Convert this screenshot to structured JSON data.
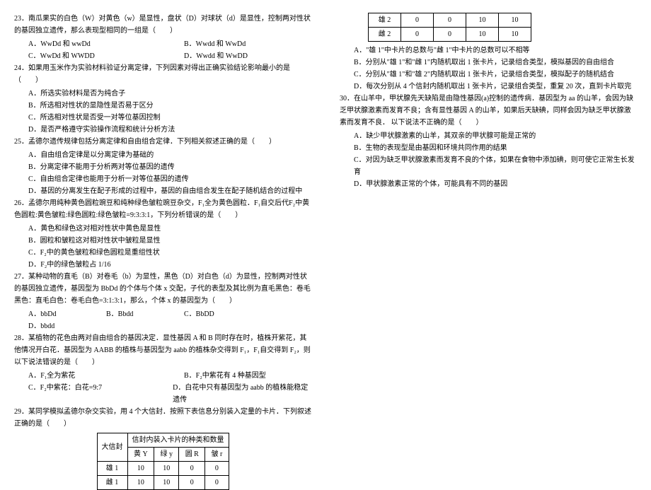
{
  "left": {
    "q23": "23．南瓜果实的白色（W）对黄色（w）是显性，盘状（D）对球状（d）是显性，控制两对性状的基因独立遗传，那么表现型相同的一组是（　　）",
    "q23a": "A．WwDd 和 wwDd",
    "q23b": "B．Wwdd 和 WwDd",
    "q23c": "C．WwDd 和 WWDD",
    "q23d": "D．Wwdd 和 WwDD",
    "q24": "24．如果用玉米作为实验材料验证分离定律，下列因素对得出正确实验结论影响最小的是（　　）",
    "q24a": "A．所选实验材料是否为纯合子",
    "q24b": "B．所选相对性状的显隐性是否易于区分",
    "q24c": "C．所选相对性状是否受一对等位基因控制",
    "q24d": "D．是否严格遵守实验操作流程和统计分析方法",
    "q25": "25．孟德尔遗传规律包括分离定律和自由组合定律．下列相关叙述正确的是（　　）",
    "q25a": "A．自由组合定律是以分离定律为基础的",
    "q25b": "B．分离定律不能用于分析两对等位基因的遗传",
    "q25c": "C．自由组合定律也能用于分析一对等位基因的遗传",
    "q25d": "D．基因的分离发生在配子形成的过程中，基因的自由组合发生在配子随机结合的过程中",
    "q26": "26．孟德尔用纯种黄色圆粒豌豆和纯种绿色皱粒豌豆杂交，F₁全为黄色圆粒．F₁自交后代F₂中黄色圆粒:黄色皱粒:绿色圆粒:绿色皱粒=9:3:3:1，下列分析错误的是（　　）",
    "q26a": "A．黄色和绿色这对相对性状中黄色是显性",
    "q26b": "B．圆粒和皱粒这对相对性状中皱粒是显性",
    "q26c": "C．F₂中的黄色皱粒和绿色圆粒是重组性状",
    "q26d": "D．F₂中的绿色皱粒占 1/16",
    "q27": "27．某种动物的直毛（B）对卷毛（b）为显性，黑色（D）对白色（d）为显性，控制两对性状的基因独立遗传，基因型为 BbDd 的个体与个体 x 交配，子代的表型及其比例为直毛黑色：卷毛黑色：直毛白色：卷毛白色=3:1:3:1，那么，个体 x 的基因型为（　　）",
    "q27a": "A．bbDd",
    "q27b": "B．Bbdd",
    "q27c": "C．BbDD",
    "q27d": "D．bbdd",
    "q28": "28．某植物的花色由两对自由组合的基因决定．显性基因 A 和 B 同时存在时，植株开紫花，其他情况开白花．基因型为 AABB 的植株与基因型为 aabb 的植株杂交得到 F₁，F₁自交得到 F₂，则以下说法错误的是（　　）",
    "q28a": "A．F₁全为紫花",
    "q28b": "B．F₂中紫花有 4 种基因型",
    "q28c": "C．F₂中紫花：白花=9:7",
    "q28d": "D．白花中只有基因型为 aabb 的植株能稳定遗传",
    "q29": "29．某同学模拟孟德尔杂交实验，用 4 个大信封．按照下表信息分别装入定量的卡片．下列叙述正确的是（　　）",
    "t1h0": "大信封",
    "t1h1": "信封内装入卡片的种类和数量",
    "t1c1": "黄 Y",
    "t1c2": "绿 y",
    "t1c3": "圆 R",
    "t1c4": "皱 r",
    "t1r1": "雄 1",
    "t1r1v1": "10",
    "t1r1v2": "10",
    "t1r1v3": "0",
    "t1r1v4": "0",
    "t1r2": "雌 1",
    "t1r2v1": "10",
    "t1r2v2": "10",
    "t1r2v3": "0",
    "t1r2v4": "0"
  },
  "right": {
    "t2r1": "雄 2",
    "t2r1v1": "0",
    "t2r1v2": "0",
    "t2r1v3": "10",
    "t2r1v4": "10",
    "t2r2": "雌 2",
    "t2r2v1": "0",
    "t2r2v2": "0",
    "t2r2v3": "10",
    "t2r2v4": "10",
    "q29a": "A．\"雄 1\"中卡片的总数与\"雌 1\"中卡片的总数可以不相等",
    "q29b": "B．分别从\"雄 1\"和\"雌 1\"内随机取出 1 张卡片，记录组合类型，模拟基因的自由组合",
    "q29c": "C．分别从\"雄 1\"和\"雄 2\"内随机取出 1 张卡片，记录组合类型，模拟配子的随机结合",
    "q29d": "D．每次分别从 4 个信封内随机取出 1 张卡片，记录组合类型，重复 20 次，直到卡片取完",
    "q30": "30．在山羊中，甲状腺先天缺陷是由隐性基因(a)控制的遗传病．基因型为 aa 的山羊，会因为缺乏甲状腺激素而发育不良；含有显性基因 A 的山羊，如果后天缺碘，同样会因为缺乏甲状腺激素而发育不良． 以下说法不正确的是（　　）",
    "q30a": "A．缺少甲状腺激素的山羊，其双亲的甲状腺可能是正常的",
    "q30b": "B．生物的表现型是由基因和环境共同作用的结果",
    "q30c": "C．对因为缺乏甲状腺激素而发育不良的个体，如果在食物中添加碘，则可使它正常生长发育",
    "q30d": "D．甲状腺激素正常的个体，可能具有不同的基因"
  }
}
